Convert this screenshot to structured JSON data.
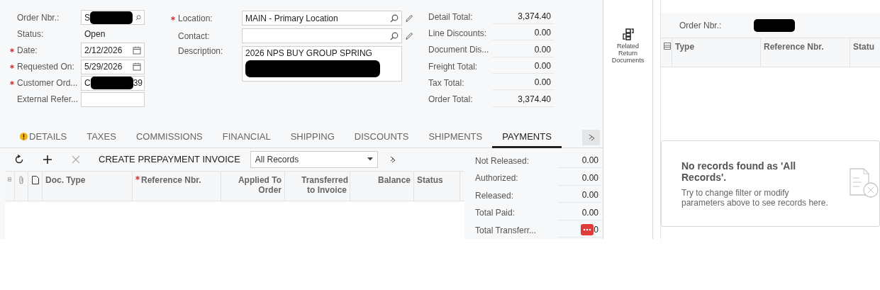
{
  "header": {
    "columns": [
      {
        "fields": [
          {
            "label": "Order Nbr.:",
            "required": false,
            "kind": "lookup",
            "value": "S",
            "redacted": true
          },
          {
            "label": "Status:",
            "required": false,
            "kind": "text",
            "value": "Open"
          },
          {
            "label": "Date:",
            "required": true,
            "kind": "date",
            "value": "2/12/2026"
          },
          {
            "label": "Requested On:",
            "required": true,
            "kind": "date",
            "value": "5/29/2026"
          },
          {
            "label": "Customer Ord...",
            "required": true,
            "kind": "input",
            "value": "C",
            "value_tail": "39",
            "redacted": true
          },
          {
            "label": "External Refer...",
            "required": false,
            "kind": "input"
          }
        ]
      },
      {
        "fields": [
          {
            "label": "Location:",
            "required": true,
            "kind": "lookup",
            "value": "MAIN - Primary Location",
            "editable": true
          },
          {
            "label": "Contact:",
            "required": false,
            "kind": "lookup",
            "editable": true
          },
          {
            "label": "Description:",
            "required": false,
            "editable": false,
            "kind": "textarea",
            "value": "2026 NPS BUY GROUP SPRING",
            "redacted": true
          }
        ]
      }
    ],
    "totals": [
      {
        "label": "Detail Total:",
        "value": "3,374.40"
      },
      {
        "label": "Line Discounts:",
        "value": "0.00"
      },
      {
        "label": "Document Dis...",
        "value": "0.00"
      },
      {
        "label": "Freight Total:",
        "value": "0.00"
      },
      {
        "label": "Tax Total:",
        "value": "0.00"
      },
      {
        "label": "Order Total:",
        "value": "3,374.40"
      }
    ]
  },
  "tabs": [
    {
      "label": "DETAILS",
      "selected": false,
      "warning": true
    },
    {
      "label": "TAXES",
      "selected": false,
      "warning": false
    },
    {
      "label": "COMMISSIONS",
      "selected": false,
      "warning": false
    },
    {
      "label": "FINANCIAL",
      "selected": false,
      "warning": false
    },
    {
      "label": "SHIPPING",
      "selected": false,
      "warning": false
    },
    {
      "label": "DISCOUNTS",
      "selected": false,
      "warning": false
    },
    {
      "label": "SHIPMENTS",
      "selected": false,
      "warning": false
    },
    {
      "label": "PAYMENTS",
      "selected": true,
      "warning": false
    }
  ],
  "toolbar": {
    "buttons": [
      {
        "kind": "refresh",
        "disabled": false
      },
      {
        "kind": "add",
        "disabled": false
      },
      {
        "kind": "delete",
        "disabled": true
      }
    ],
    "action": "CREATE PREPAYMENT INVOICE",
    "filter": "All Records"
  },
  "grid": {
    "columns": [
      {
        "label": "Doc. Type",
        "required": false
      },
      {
        "label": "Reference Nbr.",
        "required": true
      },
      {
        "label": "Applied To Order",
        "required": false
      },
      {
        "label": "Transferred to Invoice",
        "required": false
      },
      {
        "label": "Balance",
        "required": false
      },
      {
        "label": "Status",
        "required": false
      }
    ]
  },
  "payment_summary": [
    {
      "label": "Not Released:",
      "value": "0.00"
    },
    {
      "label": "Authorized:",
      "value": "0.00"
    },
    {
      "label": "Released:",
      "value": "0.00"
    },
    {
      "label": "Total Paid:",
      "value": "0.00"
    },
    {
      "label": "Total Transferr...",
      "value": "0",
      "covered": true
    }
  ],
  "side_action": {
    "label": "Related Return Documents"
  },
  "related_panel": {
    "order_label": "Order Nbr.:",
    "order_redacted": true,
    "columns": [
      "Type",
      "Reference Nbr.",
      "Statu"
    ],
    "empty_title": "No records found as 'All Records'.",
    "empty_text": "Try to change filter or modify parameters above to see records here."
  }
}
